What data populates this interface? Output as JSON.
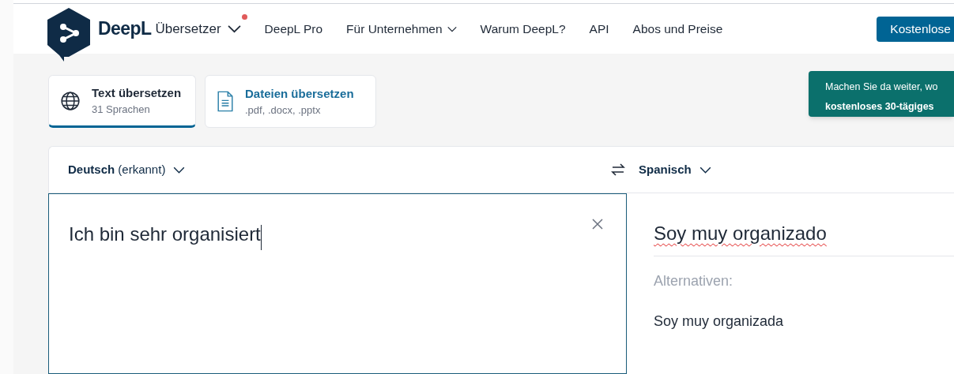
{
  "header": {
    "logo_text": "DeepL",
    "product": "Übersetzer",
    "notification_dot": true,
    "nav": [
      {
        "label": "DeepL Pro",
        "dropdown": false
      },
      {
        "label": "Für Unternehmen",
        "dropdown": true
      },
      {
        "label": "Warum DeepL?",
        "dropdown": false
      },
      {
        "label": "API",
        "dropdown": false
      },
      {
        "label": "Abos und Preise",
        "dropdown": false
      }
    ],
    "cta": "Kostenlose"
  },
  "modes": [
    {
      "kind": "text",
      "title": "Text übersetzen",
      "subtitle": "31 Sprachen",
      "selected": true
    },
    {
      "kind": "files",
      "title": "Dateien übersetzen",
      "subtitle": ".pdf, .docx, .pptx",
      "selected": false
    }
  ],
  "toast": {
    "lines": [
      {
        "text": "Machen Sie da weiter, wo",
        "bold": false
      },
      {
        "text": "kostenloses 30-tägiges",
        "bold": true
      }
    ]
  },
  "translator": {
    "source_language": "**Deutsch** (erkannt)",
    "target_language": "Spanisch",
    "source_text": "Ich bin sehr organisiert",
    "focused": true,
    "translation": "Soy muy organizado",
    "alternatives_label": "Alternativen:",
    "alternatives": [
      "Soy muy organizada"
    ]
  }
}
